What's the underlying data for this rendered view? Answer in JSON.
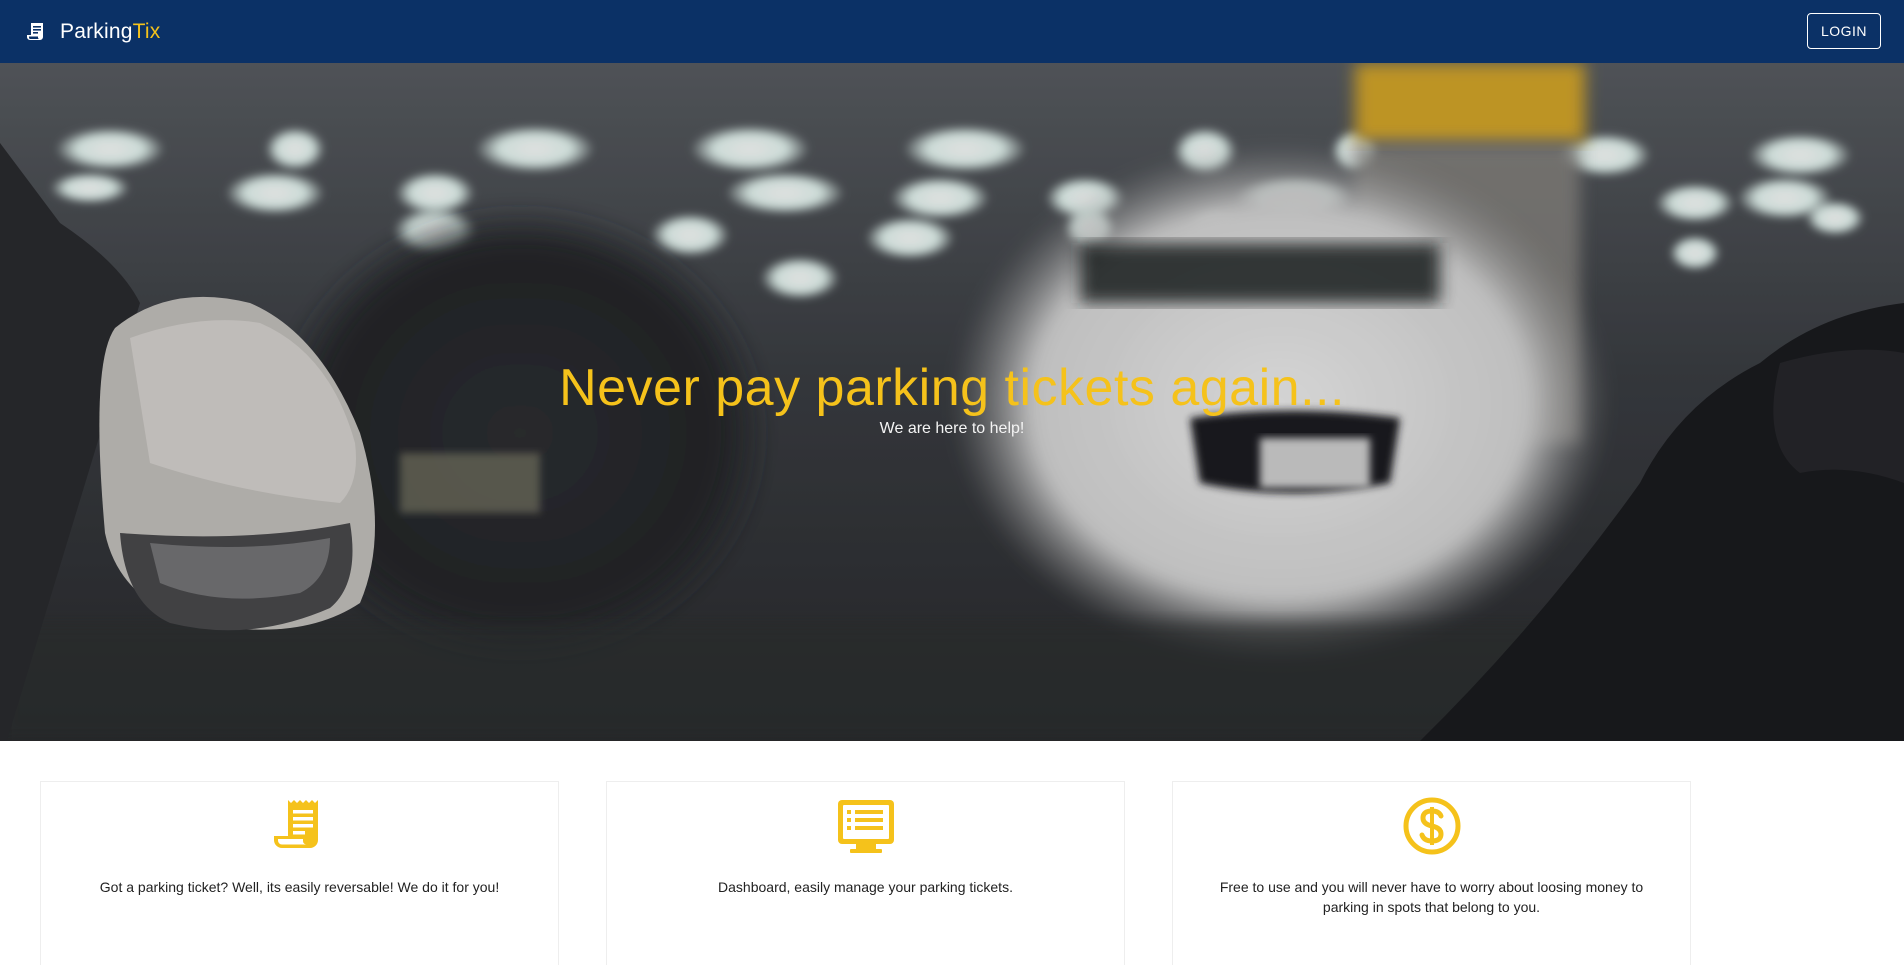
{
  "header": {
    "brand_primary": "Parking",
    "brand_accent": "Tix",
    "brand_icon": "receipt-icon",
    "login_label": "LOGIN"
  },
  "hero": {
    "title": "Never pay parking tickets again...",
    "subtitle": "We are here to help!"
  },
  "features": [
    {
      "icon": "receipt-icon",
      "text": "Got a parking ticket? Well, its easily reversable! We do it for you!"
    },
    {
      "icon": "dashboard-list-icon",
      "text": "Dashboard, easily manage your parking tickets."
    },
    {
      "icon": "dollar-icon",
      "text": "Free to use and you will never have to worry about loosing money to parking in spots that belong to you."
    }
  ],
  "colors": {
    "header_bg": "#0b3166",
    "accent": "#f5c21b",
    "white": "#ffffff"
  }
}
